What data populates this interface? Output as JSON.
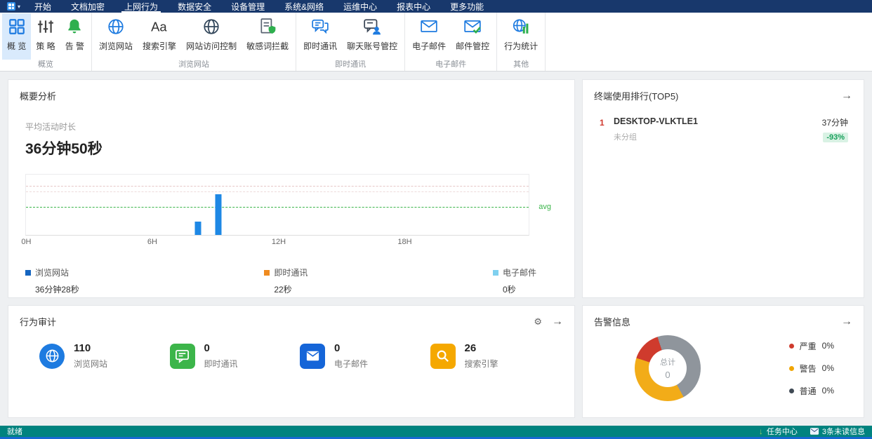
{
  "colors": {
    "menubar_bg": "#18386c",
    "statusbar_bg": "#00837f",
    "accent_blue": "#1e7be0",
    "ribbon_selected_bg": "#d9eafc",
    "green": "#2eaf4e",
    "amber": "#f5a800",
    "red": "#cf3b2d"
  },
  "menubar": {
    "items": [
      "开始",
      "文档加密",
      "上网行为",
      "数据安全",
      "设备管理",
      "系统&网络",
      "运维中心",
      "报表中心",
      "更多功能"
    ],
    "active": "上网行为"
  },
  "ribbon": {
    "groups": [
      {
        "label": "概览",
        "buttons": [
          {
            "label": "概 览",
            "icon": "grid-icon",
            "selected": true
          },
          {
            "label": "策 略",
            "icon": "strategy-icon"
          },
          {
            "label": "告 警",
            "icon": "bell-icon"
          }
        ]
      },
      {
        "label": "浏览网站",
        "buttons": [
          {
            "label": "浏览网站",
            "icon": "globe-icon"
          },
          {
            "label": "搜索引擎",
            "icon": "font-size-icon"
          },
          {
            "label": "网站访问控制",
            "icon": "web-control-icon"
          },
          {
            "label": "敏感词拦截",
            "icon": "sensitive-word-icon"
          }
        ]
      },
      {
        "label": "即时通讯",
        "buttons": [
          {
            "label": "即时通讯",
            "icon": "chat-icon"
          },
          {
            "label": "聊天账号管控",
            "icon": "chat-account-icon"
          }
        ]
      },
      {
        "label": "电子邮件",
        "buttons": [
          {
            "label": "电子邮件",
            "icon": "mail-icon"
          },
          {
            "label": "邮件管控",
            "icon": "mail-control-icon"
          }
        ]
      },
      {
        "label": "其他",
        "buttons": [
          {
            "label": "行为统计",
            "icon": "behavior-stats-icon"
          }
        ]
      }
    ]
  },
  "summary_card": {
    "title": "概要分析",
    "metric_label": "平均活动时长",
    "metric_value": "36分钟50秒"
  },
  "chart_data": {
    "type": "bar",
    "title": "平均活动时长",
    "total_value": "36分钟50秒",
    "x_ticks": [
      "0H",
      "6H",
      "12H",
      "18H"
    ],
    "x_range_hours": [
      0,
      24
    ],
    "ylabel": "",
    "grid": true,
    "bars": [
      {
        "series": "浏览网站",
        "hour": 8.2,
        "height_pct": 22,
        "color": "#1e88e5"
      },
      {
        "series": "浏览网站",
        "hour": 9.2,
        "height_pct": 68,
        "color": "#1e88e5"
      }
    ],
    "ref_lines": [
      {
        "pct": 80,
        "color": "#e6c6c6"
      },
      {
        "pct": 71,
        "color": "#eddada"
      },
      {
        "pct": 45,
        "color": "#3bb54a",
        "label": "avg"
      }
    ],
    "legend_position": "bottom",
    "legend": [
      {
        "label": "浏览网站",
        "value": "36分钟28秒",
        "color": "#1565c0"
      },
      {
        "label": "即时通讯",
        "value": "22秒",
        "color": "#ef8b1f"
      },
      {
        "label": "电子邮件",
        "value": "0秒",
        "color": "#7fd0ef"
      }
    ]
  },
  "ranking_card": {
    "title": "终端使用排行(TOP5)",
    "rows": [
      {
        "rank": "1",
        "name": "DESKTOP-VLKTLE1",
        "group": "未分组",
        "duration": "37分钟",
        "change": "-93%"
      }
    ]
  },
  "audit_card": {
    "title": "行为审计",
    "stats": [
      {
        "value": "110",
        "label": "浏览网站",
        "icon": "globe-stat-icon",
        "color": "#1e7be0"
      },
      {
        "value": "0",
        "label": "即时通讯",
        "icon": "chat-stat-icon",
        "color": "#3cb54a"
      },
      {
        "value": "0",
        "label": "电子邮件",
        "icon": "mail-stat-icon",
        "color": "#1565d8"
      },
      {
        "value": "26",
        "label": "搜索引擎",
        "icon": "search-stat-icon",
        "color": "#f5a800"
      }
    ]
  },
  "alarm_card": {
    "title": "告警信息",
    "donut": {
      "center_label": "总计",
      "center_value": "0",
      "render_segments": [
        {
          "color": "#8f959c",
          "sweep": 42
        },
        {
          "color": "#f2ac18",
          "sweep": 38
        },
        {
          "color": "#cf3b2d",
          "sweep": 15
        },
        {
          "color": "#8f959c",
          "sweep": 5
        }
      ]
    },
    "legend": [
      {
        "label": "严重",
        "value": "0%",
        "color": "#cf3b2d"
      },
      {
        "label": "警告",
        "value": "0%",
        "color": "#f0a500"
      },
      {
        "label": "普通",
        "value": "0%",
        "color": "#3f4a54"
      }
    ]
  },
  "statusbar": {
    "left": "就绪",
    "task_center": "任务中心",
    "unread": "3条未读信息"
  }
}
